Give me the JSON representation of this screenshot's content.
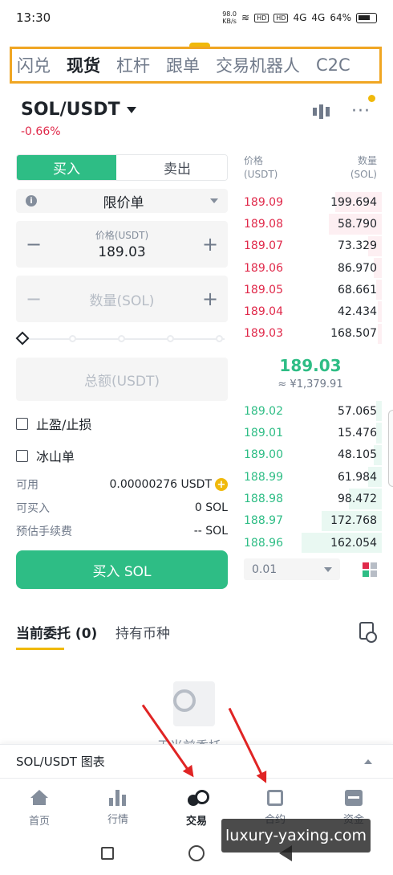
{
  "status": {
    "time": "13:30",
    "netspeed_value": "98.0",
    "netspeed_unit": "KB/s",
    "hd1": "HD",
    "hd2": "HD",
    "signal1": "4G",
    "signal2": "4G",
    "battery": "64%"
  },
  "top_tabs": [
    {
      "label": "闪兑"
    },
    {
      "label": "现货"
    },
    {
      "label": "杠杆"
    },
    {
      "label": "跟单"
    },
    {
      "label": "交易机器人"
    },
    {
      "label": "C2C"
    }
  ],
  "pair": {
    "symbol": "SOL/USDT",
    "change": "-0.66%"
  },
  "trade_form": {
    "buy_label": "买入",
    "sell_label": "卖出",
    "info_glyph": "i",
    "order_type": "限价单",
    "price_caption": "价格(USDT)",
    "price_value": "189.03",
    "minus": "−",
    "plus": "+",
    "amount_placeholder": "数量(SOL)",
    "total_placeholder": "总额(USDT)",
    "tpsl_label": "止盈/止损",
    "iceberg_label": "冰山单",
    "available_label": "可用",
    "available_value": "0.00000276 USDT",
    "max_buy_label": "可买入",
    "max_buy_value": "0 SOL",
    "fee_label": "预估手续费",
    "fee_value": "-- SOL",
    "submit_label": "买入 SOL"
  },
  "order_book": {
    "price_header": "价格",
    "price_unit": "(USDT)",
    "qty_header": "数量",
    "qty_unit": "(SOL)",
    "asks": [
      {
        "price": "189.09",
        "qty": "199.694"
      },
      {
        "price": "189.08",
        "qty": "58.790"
      },
      {
        "price": "189.07",
        "qty": "73.329"
      },
      {
        "price": "189.06",
        "qty": "86.970"
      },
      {
        "price": "189.05",
        "qty": "68.661"
      },
      {
        "price": "189.04",
        "qty": "42.434"
      },
      {
        "price": "189.03",
        "qty": "168.507"
      }
    ],
    "last_price": "189.03",
    "last_price_cny": "≈ ¥1,379.91",
    "bids": [
      {
        "price": "189.02",
        "qty": "57.065"
      },
      {
        "price": "189.01",
        "qty": "15.476"
      },
      {
        "price": "189.00",
        "qty": "48.105"
      },
      {
        "price": "188.99",
        "qty": "61.984"
      },
      {
        "price": "188.98",
        "qty": "98.472"
      },
      {
        "price": "188.97",
        "qty": "172.768"
      },
      {
        "price": "188.96",
        "qty": "162.054"
      }
    ],
    "depth_precision": "0.01"
  },
  "orders_section": {
    "open_orders_tab": "当前委托 (0)",
    "holdings_tab": "持有币种",
    "empty_text": "无当前委托"
  },
  "chart_bar": {
    "label": "SOL/USDT 图表"
  },
  "bottom_nav": [
    {
      "label": "首页",
      "icon": "home-icon"
    },
    {
      "label": "行情",
      "icon": "markets-icon"
    },
    {
      "label": "交易",
      "icon": "trade-icon"
    },
    {
      "label": "合约",
      "icon": "futures-icon"
    },
    {
      "label": "资金",
      "icon": "wallet-icon"
    }
  ],
  "watermark": "luxury-yaxing.com",
  "colors": {
    "accent": "#f0b90b",
    "buy": "#2ebd85",
    "sell": "#e0294a",
    "highlight_box": "#f0a623",
    "annotation_arrow": "#e02424"
  }
}
